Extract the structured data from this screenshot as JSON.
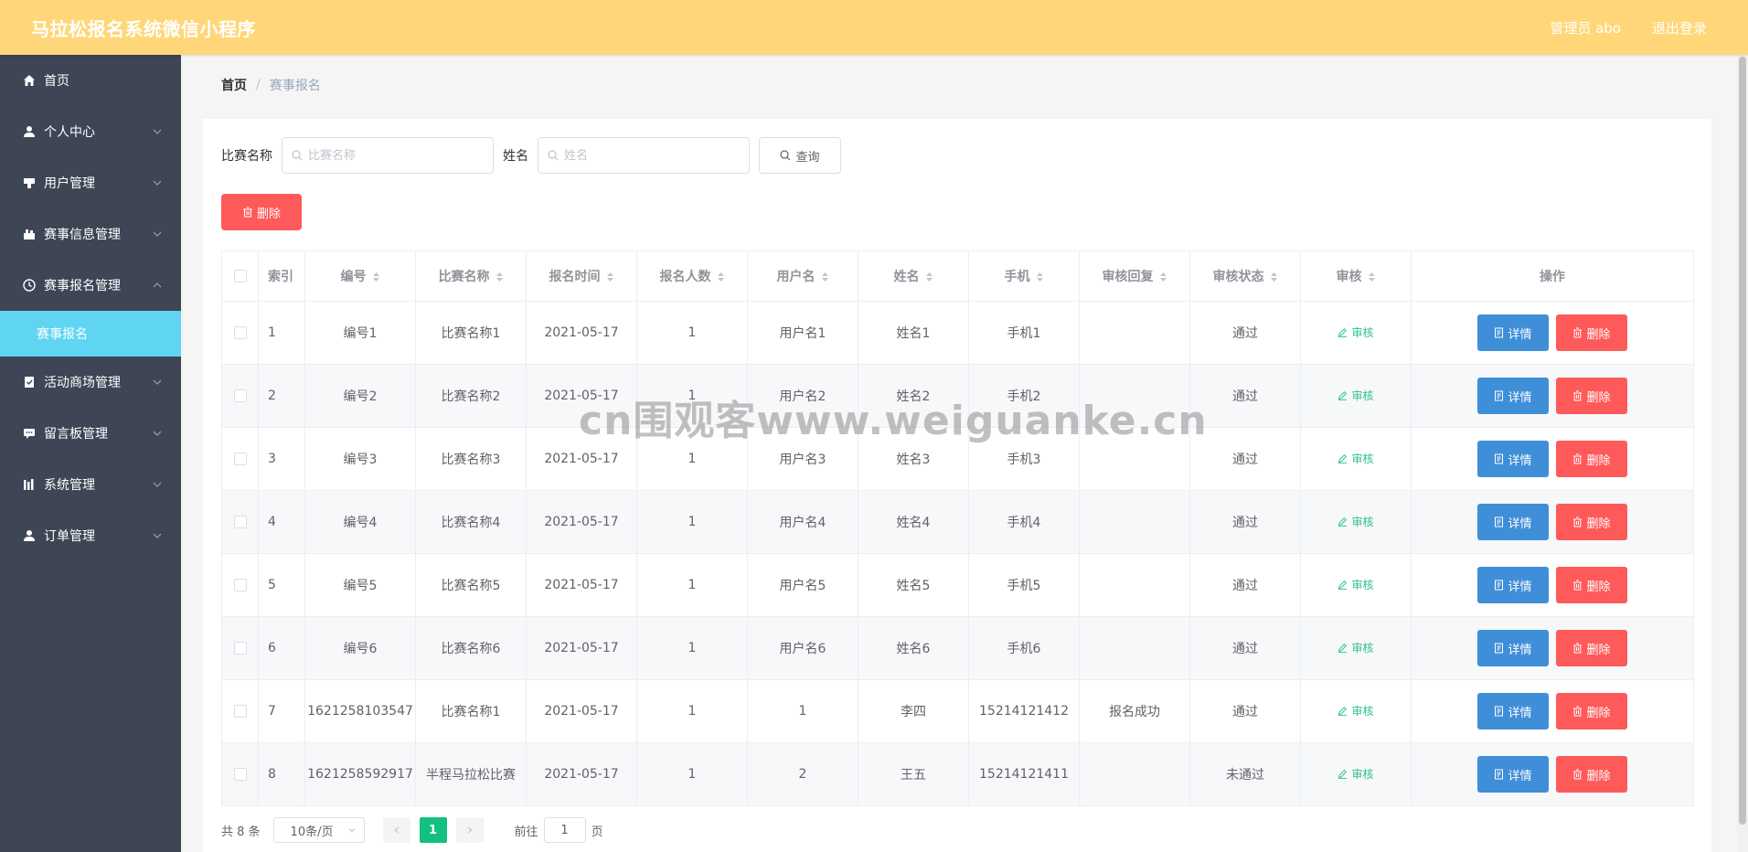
{
  "app": {
    "title": "马拉松报名系统微信小程序"
  },
  "header": {
    "user_label": "管理员 abo",
    "logout_label": "退出登录"
  },
  "sidebar": {
    "items": [
      {
        "label": "首页",
        "icon": "home-icon"
      },
      {
        "label": "个人中心",
        "icon": "user-icon"
      },
      {
        "label": "用户管理",
        "icon": "users-icon"
      },
      {
        "label": "赛事信息管理",
        "icon": "event-icon"
      },
      {
        "label": "赛事报名管理",
        "icon": "clock-icon"
      },
      {
        "label": "活动商场管理",
        "icon": "shop-icon"
      },
      {
        "label": "留言板管理",
        "icon": "message-icon"
      },
      {
        "label": "系统管理",
        "icon": "system-icon"
      },
      {
        "label": "订单管理",
        "icon": "order-icon"
      }
    ],
    "active_sub": "赛事报名"
  },
  "breadcrumb": {
    "home": "首页",
    "separator": "/",
    "current": "赛事报名"
  },
  "search": {
    "match_label": "比赛名称",
    "match_placeholder": "比赛名称",
    "name_label": "姓名",
    "name_placeholder": "姓名",
    "query_label": "查询"
  },
  "toolbar": {
    "delete_label": "删除"
  },
  "table": {
    "headers": [
      "索引",
      "编号",
      "比赛名称",
      "报名时间",
      "报名人数",
      "用户名",
      "姓名",
      "手机",
      "审核回复",
      "审核状态",
      "审核",
      "操作"
    ],
    "audit_label": "审核",
    "detail_label": "详情",
    "delete_label": "删除",
    "rows": [
      {
        "index": "1",
        "code": "编号1",
        "match": "比赛名称1",
        "time": "2021-05-17",
        "count": "1",
        "username": "用户名1",
        "name": "姓名1",
        "phone": "手机1",
        "reply": "",
        "status": "通过"
      },
      {
        "index": "2",
        "code": "编号2",
        "match": "比赛名称2",
        "time": "2021-05-17",
        "count": "1",
        "username": "用户名2",
        "name": "姓名2",
        "phone": "手机2",
        "reply": "",
        "status": "通过"
      },
      {
        "index": "3",
        "code": "编号3",
        "match": "比赛名称3",
        "time": "2021-05-17",
        "count": "1",
        "username": "用户名3",
        "name": "姓名3",
        "phone": "手机3",
        "reply": "",
        "status": "通过"
      },
      {
        "index": "4",
        "code": "编号4",
        "match": "比赛名称4",
        "time": "2021-05-17",
        "count": "1",
        "username": "用户名4",
        "name": "姓名4",
        "phone": "手机4",
        "reply": "",
        "status": "通过"
      },
      {
        "index": "5",
        "code": "编号5",
        "match": "比赛名称5",
        "time": "2021-05-17",
        "count": "1",
        "username": "用户名5",
        "name": "姓名5",
        "phone": "手机5",
        "reply": "",
        "status": "通过"
      },
      {
        "index": "6",
        "code": "编号6",
        "match": "比赛名称6",
        "time": "2021-05-17",
        "count": "1",
        "username": "用户名6",
        "name": "姓名6",
        "phone": "手机6",
        "reply": "",
        "status": "通过"
      },
      {
        "index": "7",
        "code": "1621258103547",
        "match": "比赛名称1",
        "time": "2021-05-17",
        "count": "1",
        "username": "1",
        "name": "李四",
        "phone": "15214121412",
        "reply": "报名成功",
        "status": "通过"
      },
      {
        "index": "8",
        "code": "1621258592917",
        "match": "半程马拉松比赛",
        "time": "2021-05-17",
        "count": "1",
        "username": "2",
        "name": "王五",
        "phone": "15214121411",
        "reply": "",
        "status": "未通过"
      }
    ]
  },
  "pagination": {
    "total_label": "共 8 条",
    "page_size_label": "10条/页",
    "current_page": "1",
    "goto_prefix": "前往",
    "goto_value": "1",
    "goto_suffix": "页"
  },
  "watermark": "cn围观客www.weiguanke.cn",
  "colors": {
    "header": "#ffd779",
    "sidebar": "#3e4555",
    "active_sub": "#60d5f2",
    "detail": "#3f8fd8",
    "danger": "#ff5a5a",
    "pager_active": "#13c080",
    "audit_link": "#2bc28d"
  }
}
